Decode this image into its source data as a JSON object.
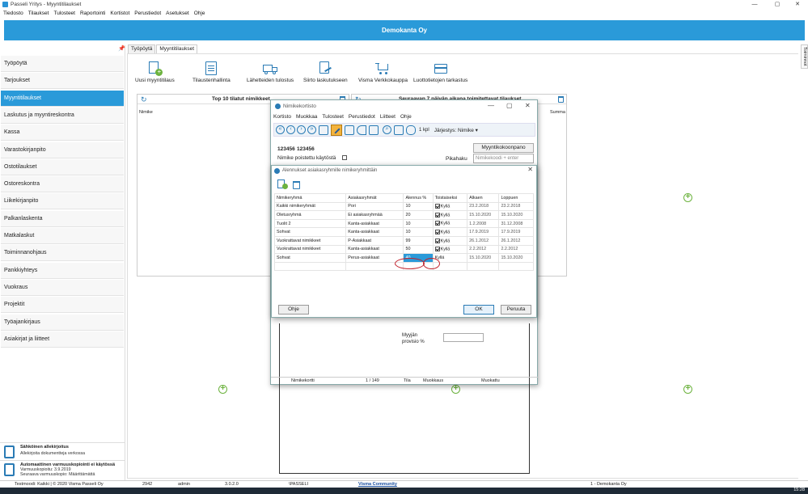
{
  "window": {
    "title": "Passeli Yritys - Myyntitilaukset",
    "min": "—",
    "max": "▢",
    "close": "✕"
  },
  "menu": [
    "Tiedosto",
    "Tilaukset",
    "Tulosteet",
    "Raportointi",
    "Kortistot",
    "Perustiedot",
    "Asetukset",
    "Ohje"
  ],
  "company": "Demokanta Oy",
  "sidebar": {
    "pin": "📌",
    "items": [
      "Työpöytä",
      "Tarjoukset",
      "Myyntitilaukset",
      "Laskutus ja myyntireskontra",
      "Kassa",
      "Varastokirjanpito",
      "Ostotilaukset",
      "Ostoreskontra",
      "Liikekirjanpito",
      "Palkanlaskenta",
      "Matkalaskut",
      "Toiminnanohjaus",
      "Pankkiyhteys",
      "Vuokraus",
      "Projektit",
      "Työajankirjaus",
      "Asiakirjat ja liitteet"
    ],
    "active_index": 2,
    "promo1": {
      "title": "Sähköinen allekirjoitus",
      "line1": "Allekirjoita dokumentteja verkossa"
    },
    "promo2": {
      "title": "Automaattinen varmuuskopiointi ei käytössä",
      "line1": "Varmuuskopioitu: 3.9.2019",
      "line2": "Seuraava varmuuskopio: Määrittämättä"
    }
  },
  "tabs": [
    "Työpöytä",
    "Myyntitilaukset"
  ],
  "side_tab": "Toiminnot",
  "toolbar": [
    "Uusi myyntitilaus",
    "Tilaustenhallinta",
    "Lähetteiden tulostus",
    "Siirto laskutukseen",
    "Visma Verkkokauppa",
    "Luottotietojen tarkastus"
  ],
  "panels": {
    "left_title": "Top 10 tilatut nimikkeet",
    "left_col": "Nimike",
    "right_title": "Seuraavan 7 päivän aikana toimitettavat tilaukset",
    "right_col": "Summa"
  },
  "nimikekortisto": {
    "title": "Nimikekortisto",
    "menu": [
      "Kortisto",
      "Muokkaa",
      "Tulosteet",
      "Perustiedot",
      "Liitteet",
      "Ohje"
    ],
    "count": "1 kpl",
    "sort": "Järjestys: Nimike ▾",
    "item_code": "123456",
    "item_name": "123456",
    "deleted_label": "Nimike poistettu käytöstä",
    "compose_button": "Myyntikokoonpano",
    "quicksearch_label": "Pikahaku",
    "quicksearch_placeholder": "Nimikekoodi + enter",
    "seller_label": "Myyjän",
    "seller_label2": "provisio %",
    "footer": {
      "a": "Nimikekortti",
      "b": "1 / 149",
      "c": "Tila",
      "d": "Muokkaus",
      "e": "Muokattu"
    }
  },
  "discounts": {
    "title": "Alennukset asiakasryhmille nimikeryhmittäin",
    "columns": [
      "Nimikeryhmä",
      "Asiakasryhmät",
      "Alennus %",
      "Toistaiseksi",
      "Alkaen",
      "Loppuen"
    ],
    "rows": [
      {
        "group": "Kaikki nimikeryhmät",
        "customer": "Pori",
        "discount": "10",
        "indef": "Kyllä",
        "start": "23.2.2018",
        "end": "23.2.2018"
      },
      {
        "group": "Oletusryhmä",
        "customer": "Ei asiakasryhmää",
        "discount": "20",
        "indef": "Kyllä",
        "start": "15.10.2020",
        "end": "15.10.2020"
      },
      {
        "group": "Tuolit 2",
        "customer": "Kanta-asiakkaat",
        "discount": "10",
        "indef": "Kyllä",
        "start": "1.2.2008",
        "end": "31.12.2008"
      },
      {
        "group": "Sohvat",
        "customer": "Kanta-asiakkaat",
        "discount": "10",
        "indef": "Kyllä",
        "start": "17.9.2019",
        "end": "17.9.2019"
      },
      {
        "group": "Vuokrattavat nimikkeet",
        "customer": "P-Asiakkaat",
        "discount": "99",
        "indef": "Kyllä",
        "start": "26.1.2012",
        "end": "26.1.2012"
      },
      {
        "group": "Vuokrattavat nimikkeet",
        "customer": "Kanta-asiakkaat",
        "discount": "50",
        "indef": "Kyllä",
        "start": "2.2.2012",
        "end": "2.2.2012"
      },
      {
        "group": "Sohvat",
        "customer": "Perus-asiakkaat",
        "discount": "40",
        "indef": "Kyllä",
        "start": "15.10.2020",
        "end": "15.10.2020"
      }
    ],
    "help": "Ohje",
    "ok": "OK",
    "cancel": "Peruuta"
  },
  "status": {
    "mode": "Testmoodi: Kaikki | © 2020 Visma Passeli Oy",
    "n": "2942",
    "user": "admin",
    "ver": "3.0.2.0",
    "path": "\\PASSELI",
    "community": "Visma Community",
    "db": "1 - Demokanta Oy"
  },
  "clock": "15:28",
  "colors": {
    "accent": "#2a9ad9",
    "highlight_ring": "#c0202a",
    "add_green": "#6db33f"
  }
}
